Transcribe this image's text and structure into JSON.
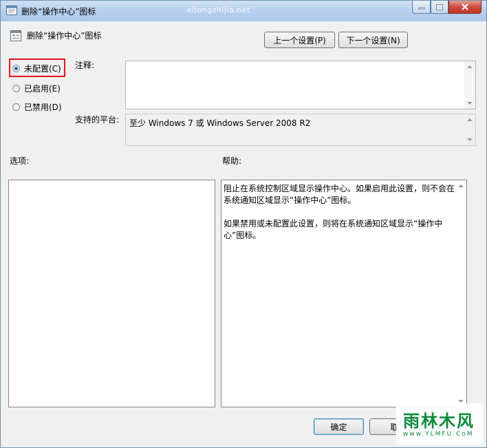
{
  "window": {
    "title": "删除“操作中心”图标",
    "watermark_url": "xitongzhijia.net",
    "controls": [
      "minimize",
      "maximize",
      "close"
    ]
  },
  "header": {
    "title": "删除“操作中心”图标",
    "prev_label": "上一个设置(P)",
    "next_label": "下一个设置(N)"
  },
  "state": {
    "options": [
      {
        "label": "未配置(C)",
        "selected": true
      },
      {
        "label": "已启用(E)",
        "selected": false
      },
      {
        "label": "已禁用(D)",
        "selected": false
      }
    ]
  },
  "comment": {
    "label": "注释:",
    "value": ""
  },
  "platform": {
    "label": "支持的平台:",
    "value": "至少 Windows 7 或 Windows Server 2008 R2"
  },
  "panes": {
    "options_label": "选项:",
    "help_label": "帮助:"
  },
  "help": {
    "paragraphs": [
      "阻止在系统控制区域显示操作中心。如果启用此设置，则不会在系统通知区域显示“操作中心”图标。",
      "如果禁用或未配置此设置，则将在系统通知区域显示“操作中心”图标。"
    ]
  },
  "footer": {
    "ok_label": "确定",
    "cancel_label": "取"
  },
  "watermark_logo": {
    "text": "雨林木风",
    "url": "www.YLMFU.CoM"
  },
  "colors": {
    "highlight": "#e3141c",
    "radio_dot": "#1d5fa6",
    "logo": "#0a8a3a"
  }
}
